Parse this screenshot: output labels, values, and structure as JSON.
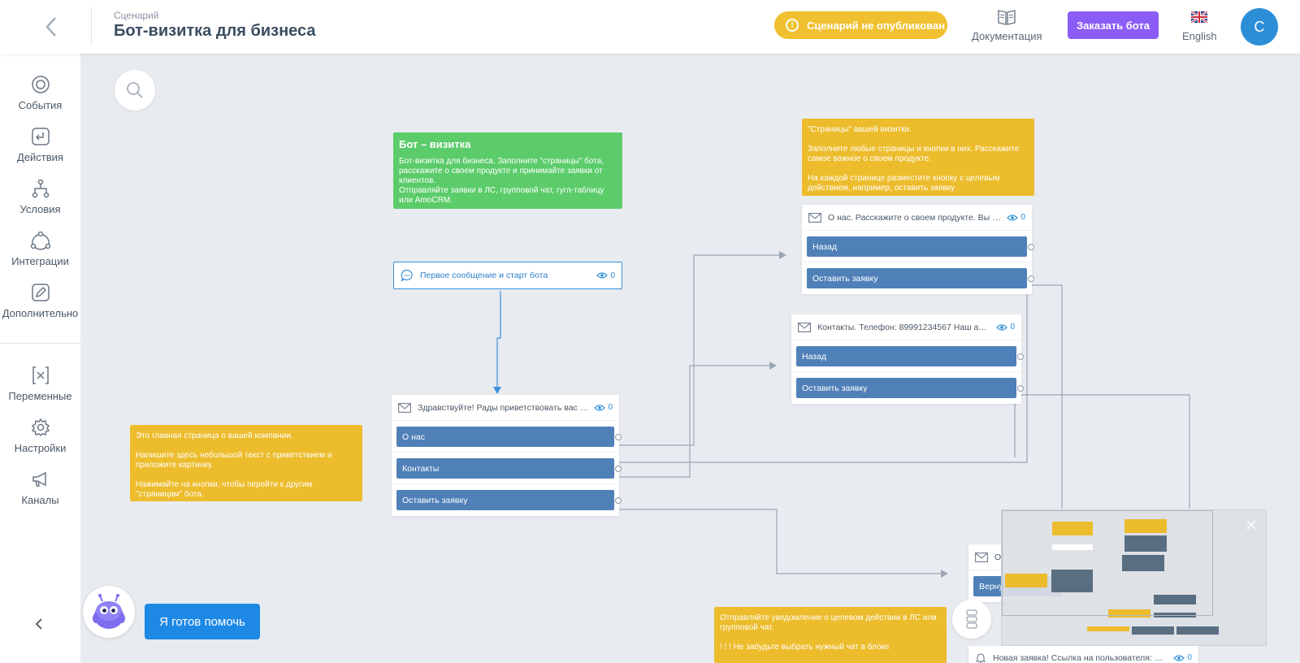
{
  "header": {
    "breadcrumb": "Сценарий",
    "title": "Бот-визитка для бизнеса",
    "status": "Сценарий не опубликован",
    "docs_label": "Документация",
    "order_label": "Заказать бота",
    "lang_label": "English",
    "avatar_initial": "C"
  },
  "sidebar": {
    "items": [
      {
        "label": "События",
        "icon": "target-icon"
      },
      {
        "label": "Действия",
        "icon": "return-arrow-icon"
      },
      {
        "label": "Условия",
        "icon": "branch-icon"
      },
      {
        "label": "Интеграции",
        "icon": "cycle-icon"
      },
      {
        "label": "Дополнительно",
        "icon": "edit-icon"
      },
      {
        "label": "Переменные",
        "icon": "variable-icon"
      },
      {
        "label": "Настройки",
        "icon": "gear-icon"
      },
      {
        "label": "Каналы",
        "icon": "megaphone-icon"
      }
    ]
  },
  "notes": {
    "intro": {
      "title": "Бот – визитка",
      "text": "Бот-визитка для бизнеса. Заполните \"страницы\" бота, расскажите о своем продукте и принимайте заявки от клиентов.",
      "text2": "Отправляйте заявки в ЛС, групповой чат, гугл-таблицу или AmoCRM."
    },
    "pages": {
      "p1": "\"Страницы\" вашей визитки.",
      "p2": "Заполните любые страницы и кнопки в них. Расскажите самое важное о своем продукте.",
      "p3": "На каждой странице разместите кнопку с целевым действием, например, оставить заявку"
    },
    "main": {
      "p1": "Это главная страница о вашей компании.",
      "p2": "Напишите здесь небольшой текст с приветствием и приложите картинку.",
      "p3": "Нажимайте на кнопки, чтобы перейти к другим \"страницам\" бота."
    },
    "notify": {
      "p1": "Отправляйте уведомление о целевом действии в ЛС или групповой чат.",
      "p2": "! ! ! Не забудьте выбрать нужный чат в блоке"
    }
  },
  "start_block": {
    "label": "Первое сообщение и старт бота",
    "views": "0"
  },
  "blocks": {
    "welcome": {
      "text": "Здравствуйте! Рады приветствовать вас в ...",
      "views": "0",
      "buttons": [
        "О нас",
        "Контакты",
        "Оставить заявку"
      ]
    },
    "about": {
      "text": "О нас. Расскажите о своем продукте. Вы м...",
      "views": "0",
      "buttons": [
        "Назад",
        "Оставить заявку"
      ]
    },
    "contacts": {
      "text": "Контакты. Телефон: 89991234567 Наш адр...",
      "views": "0",
      "buttons": [
        "Назад",
        "Оставить заявку"
      ]
    },
    "request": {
      "text": "О",
      "button": "Верну"
    },
    "notify_block": {
      "text": "Новая заявка! Ссылка на пользователя: %u...",
      "views": "0"
    }
  },
  "helper": {
    "label": "Я готов помочь"
  },
  "colors": {
    "accent": "#1e88e5",
    "warning": "#f0c030",
    "order": "#8b5cf6",
    "flow_button": "#5080b8",
    "note_green": "#5ccc6b",
    "note_yellow": "#ecbc2c"
  }
}
